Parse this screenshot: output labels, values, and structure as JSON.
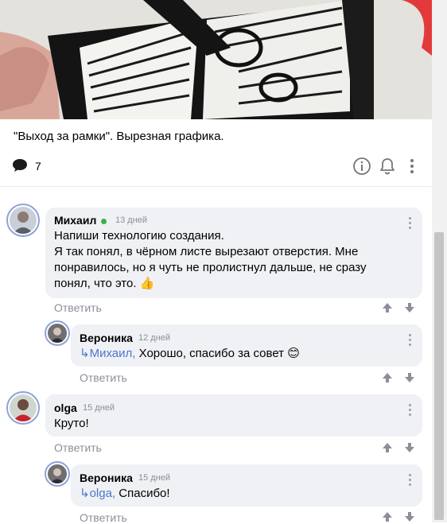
{
  "post": {
    "caption": "\"Выход за рамки\". Вырезная графика.",
    "comments_count": "7"
  },
  "comments": [
    {
      "author": "Михаил",
      "age": "13 дней",
      "line1": "Напиши технологию создания.",
      "line2": "Я так понял, в чёрном листе вырезают отверстия. Мне",
      "line3": "понравилось, но я чуть не пролистнул дальше, не сразу",
      "line4": "понял, что это.",
      "emoji": "👍",
      "reply": "Ответить"
    },
    {
      "author": "Вероника",
      "age": "12 дней",
      "mention": "Михаил,",
      "text": "Хорошо, спасибо за совет",
      "emoji": "😊",
      "reply": "Ответить"
    },
    {
      "author": "olga",
      "age": "15 дней",
      "text": "Круто!",
      "reply": "Ответить"
    },
    {
      "author": "Вероника",
      "age": "15 дней",
      "mention": "olga,",
      "text": "Спасибо!",
      "reply": "Ответить"
    }
  ],
  "icons": {
    "comment": "speech-bubble-icon",
    "info": "info-icon",
    "bell": "bell-icon",
    "more": "more-vertical-icon",
    "up": "arrow-up-icon",
    "down": "arrow-down-icon",
    "reply_arrow": "reply-arrow-icon"
  },
  "colors": {
    "accent": "#4a76d0",
    "muted": "#8a8f99",
    "bubble": "#f0f1f4",
    "online": "#38b24a"
  }
}
